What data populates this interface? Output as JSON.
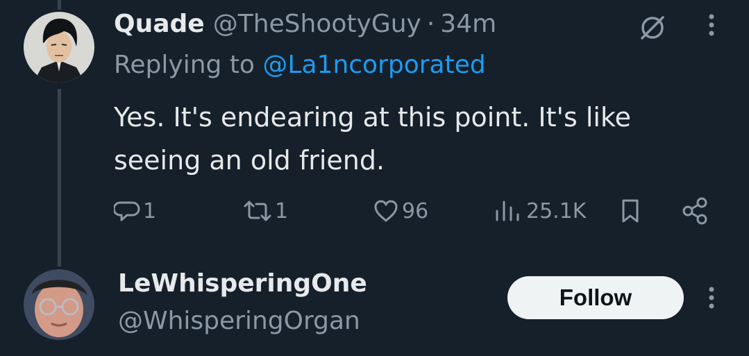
{
  "tweet": {
    "author_name": "Quade",
    "author_handle": "@TheShootyGuy",
    "separator": "·",
    "time": "34m",
    "replying_prefix": "Replying to",
    "replying_to": "@La1ncorporated",
    "text": "Yes. It's endearing at this point. It's like seeing an old friend.",
    "actions": {
      "replies": "1",
      "retweets": "1",
      "likes": "96",
      "views": "25.1K"
    }
  },
  "suggested_user": {
    "name": "LeWhisperingOne",
    "handle": "@WhisperingOrgan",
    "follow_label": "Follow"
  },
  "icons": {
    "reply": "reply-icon",
    "retweet": "retweet-icon",
    "like": "heart-icon",
    "views": "views-icon",
    "bookmark": "bookmark-icon",
    "share": "share-icon",
    "more": "more-icon",
    "no_sign": "no-sign-icon"
  },
  "colors": {
    "background": "#15202b",
    "text": "#e7e9ea",
    "secondary_text": "#8b98a5",
    "accent": "#1d9bf0",
    "thread_line": "#38444d",
    "follow_button": "#eff3f4"
  }
}
